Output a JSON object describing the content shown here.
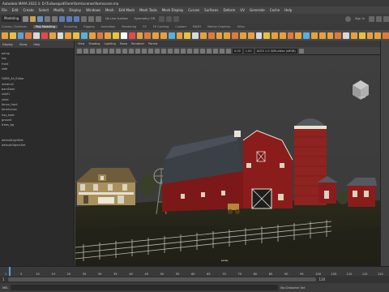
{
  "window": {
    "title": "Autodesk MAYA 2022.3: D:\\Turbosquid\\Farm\\farm\\scenes\\farmscene.ma"
  },
  "menubar": [
    "File",
    "Edit",
    "Create",
    "Select",
    "Modify",
    "Display",
    "Windows",
    "Mesh",
    "Edit Mesh",
    "Mesh Tools",
    "Mesh Display",
    "Curves",
    "Surfaces",
    "Deform",
    "UV",
    "Generate",
    "Cache",
    "Help"
  ],
  "statusline": {
    "mode": "Modeling",
    "surface_label": "No Live Surface",
    "symmetry_label": "Symmetry: Off",
    "sign_in": "Sign In"
  },
  "shelf_tabs": [
    {
      "label": "Curves / Surfaces",
      "active": false
    },
    {
      "label": "Poly Modeling",
      "active": true
    },
    {
      "label": "Sculpting",
      "active": false
    },
    {
      "label": "Rigging",
      "active": false
    },
    {
      "label": "Animation",
      "active": false
    },
    {
      "label": "Rendering",
      "active": false
    },
    {
      "label": "FX",
      "active": false
    },
    {
      "label": "FX Caching",
      "active": false
    },
    {
      "label": "Custom",
      "active": false
    },
    {
      "label": "MASH",
      "active": false
    },
    {
      "label": "Motion Graphics",
      "active": false
    },
    {
      "label": "XGen",
      "active": false
    }
  ],
  "shelf_icon_colors": [
    "#e8a13a",
    "#e7c23c",
    "#5d9fd8",
    "#e07a3b",
    "#d8d8d8",
    "#e04a4a",
    "#e8a13a",
    "#d9d9d9",
    "#e8a13a",
    "#e7c23c",
    "#56b0e0",
    "#e8a13a",
    "#e07a3b",
    "#e8a13a",
    "#e8c63b",
    "#ffffff",
    "#e04a4a",
    "#e8a13a",
    "#e07a3b",
    "#e8a13a",
    "#e8a13a",
    "#56b0e0",
    "#e8a13a",
    "#e7c23c",
    "#d9d9d9",
    "#e8a13a",
    "#e07a3b",
    "#e8a13a",
    "#e8a13a",
    "#e07a3b",
    "#e8a13a",
    "#e8a13a",
    "#d9d9d9",
    "#e7c23c",
    "#e8a13a",
    "#e8a13a",
    "#e07a3b",
    "#e8a13a",
    "#56b0e0",
    "#e8a13a",
    "#e8a13a",
    "#e8a13a",
    "#e07a3b",
    "#d9d9d9",
    "#e8a13a",
    "#e7c23c",
    "#e8a13a",
    "#e8a13a",
    "#e07a3b"
  ],
  "outliner": {
    "menu": [
      "Display",
      "Show",
      "Help"
    ],
    "items": [
      "persp",
      "top",
      "front",
      "side",
      "",
      "FARM_All_Editor",
      "windmill",
      "barnDoor",
      "silo01",
      "shed",
      "fence_front",
      "farmhouse",
      "hay_bale",
      "ground",
      "trees_bg",
      "",
      "",
      "defaultLightSet",
      "defaultObjectSet"
    ]
  },
  "viewport": {
    "menu": [
      "View",
      "Shading",
      "Lighting",
      "Show",
      "Renderer",
      "Panels"
    ],
    "readout_value": "0.00",
    "readout_scale": "1.00",
    "colorspace": "ACES 1.0 SDR-video (sRGB)",
    "camera_label": "persp",
    "cube_label": "FRONT"
  },
  "timeline": {
    "ticks": [
      "1",
      "5",
      "10",
      "15",
      "20",
      "25",
      "30",
      "35",
      "40",
      "45",
      "50",
      "55",
      "60",
      "65",
      "70",
      "75",
      "80",
      "85",
      "90",
      "95",
      "100",
      "105",
      "110",
      "115",
      "120"
    ],
    "current_frame": "1"
  },
  "range": {
    "start": "1",
    "end": "120"
  },
  "bottom": {
    "mel_label": "MEL",
    "character": "No Character Set"
  },
  "colors": {
    "barn": "#8b1c1c",
    "roof": "#3b3f46",
    "grass": "#2f2e1c",
    "accent": "#5fa0d8"
  }
}
